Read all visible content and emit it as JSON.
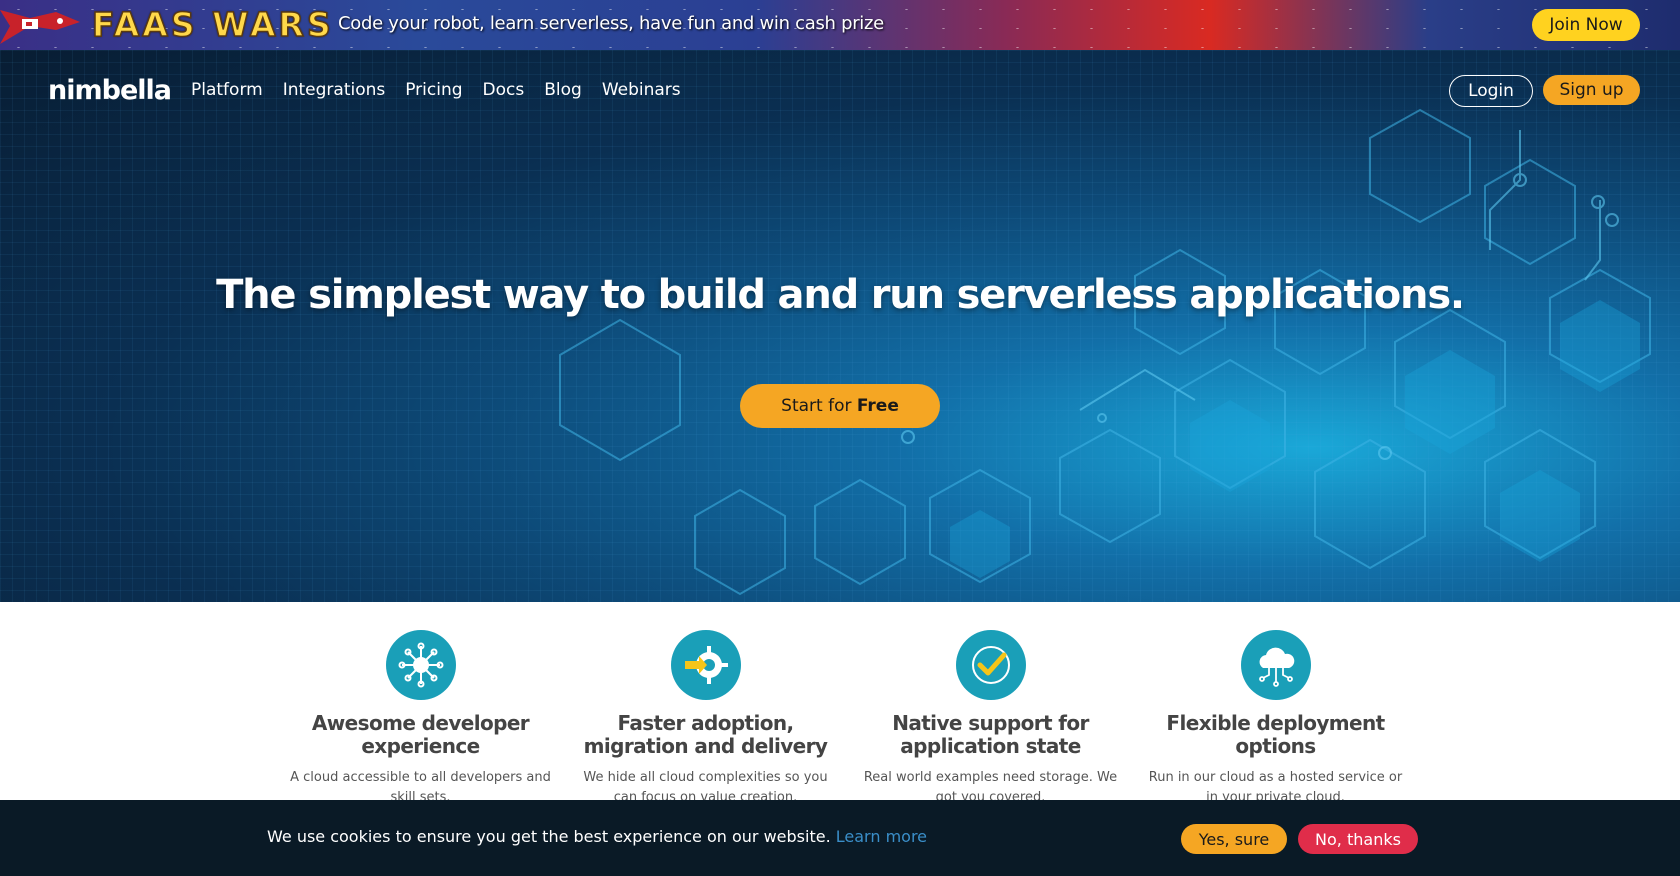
{
  "promo": {
    "brand": "FAAS WARS",
    "tagline": "Code your robot, learn serverless, have fun and win cash prize",
    "join_label": "Join Now"
  },
  "nav": {
    "logo_text": "nimbella",
    "links": [
      "Platform",
      "Integrations",
      "Pricing",
      "Docs",
      "Blog",
      "Webinars"
    ],
    "login_label": "Login",
    "signup_label": "Sign up"
  },
  "hero": {
    "title": "The simplest way to build and run serverless applications.",
    "cta_prefix": "Start for",
    "cta_emphasis": "Free"
  },
  "features": [
    {
      "icon": "network-hub-icon",
      "title": "Awesome developer experience",
      "text": "A cloud accessible to all developers and skill sets."
    },
    {
      "icon": "gear-arrow-icon",
      "title": "Faster adoption, migration and delivery",
      "text": "We hide all cloud complexities so you can focus on value creation."
    },
    {
      "icon": "checkmark-circle-icon",
      "title": "Native support for application state",
      "text": "Real world examples need storage. We got you covered."
    },
    {
      "icon": "cloud-network-icon",
      "title": "Flexible deployment options",
      "text": "Run in our cloud as a hosted service or in your private cloud."
    }
  ],
  "cookie": {
    "message": "We use cookies to ensure you get the best experience on our website.",
    "learn_more": "Learn more",
    "accept_label": "Yes, sure",
    "decline_label": "No, thanks"
  },
  "colors": {
    "accent": "#f5a623",
    "feature_icon_bg": "#1a9fb8",
    "decline": "#e02d4a",
    "promo_join": "#ffd21f"
  }
}
